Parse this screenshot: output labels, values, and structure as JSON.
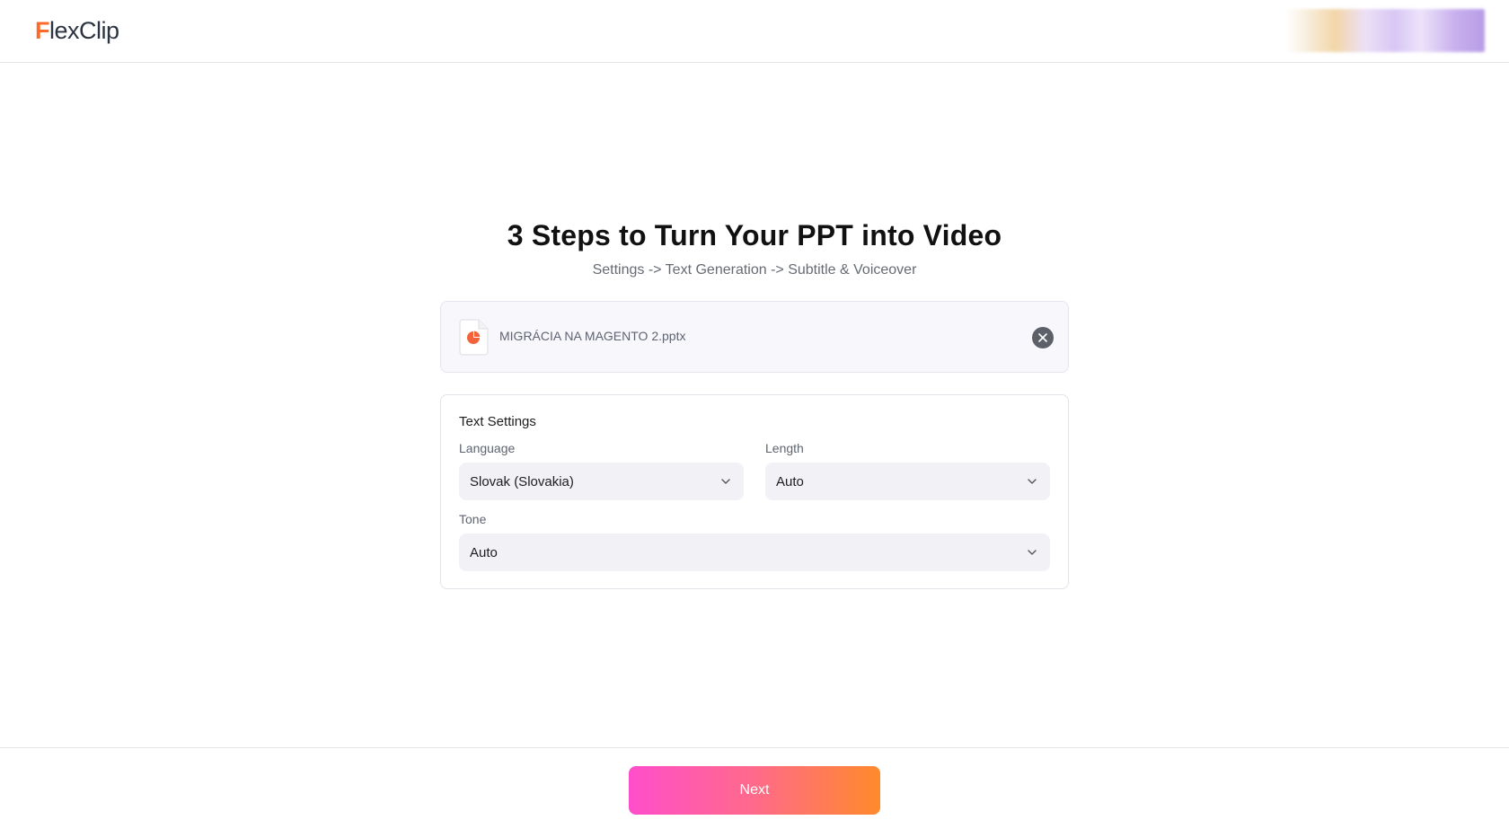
{
  "header": {
    "logo_first_letter": "F",
    "logo_rest": "lexClip"
  },
  "main": {
    "title": "3 Steps to Turn Your PPT into Video",
    "subtitle": "Settings -> Text Generation -> Subtitle & Voiceover"
  },
  "file": {
    "name": "MIGRÁCIA NA MAGENTO 2.pptx",
    "icon": "pptx-file-icon",
    "remove_icon": "close-icon"
  },
  "text_settings": {
    "title": "Text Settings",
    "language": {
      "label": "Language",
      "value": "Slovak (Slovakia)"
    },
    "length": {
      "label": "Length",
      "value": "Auto"
    },
    "tone": {
      "label": "Tone",
      "value": "Auto"
    }
  },
  "footer": {
    "next_label": "Next"
  },
  "colors": {
    "brand_orange": "#ff6a2b",
    "button_gradient_start": "#ff4ecb",
    "button_gradient_end": "#ff8a2a"
  }
}
